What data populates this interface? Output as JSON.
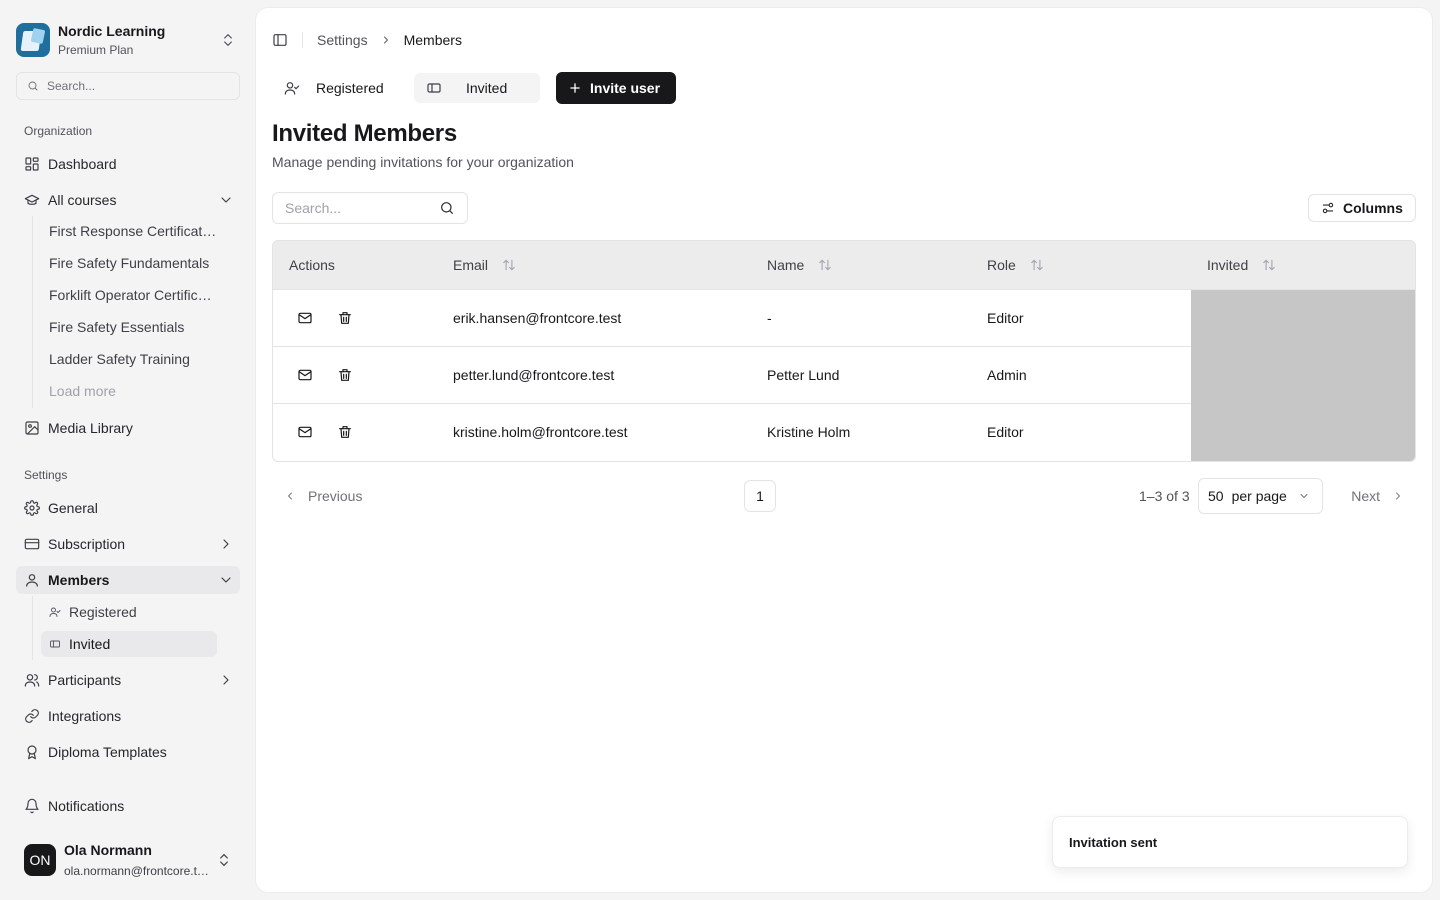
{
  "sidebar": {
    "org": {
      "name": "Nordic Learning",
      "plan": "Premium Plan"
    },
    "search_placeholder": "Search...",
    "organization_label": "Organization",
    "dashboard": "Dashboard",
    "all_courses": "All courses",
    "courses": [
      "First Response Certification",
      "Fire Safety Fundamentals",
      "Forklift Operator Certification",
      "Fire Safety Essentials",
      "Ladder Safety Training"
    ],
    "load_more": "Load more",
    "media_library": "Media Library",
    "settings_label": "Settings",
    "general": "General",
    "subscription": "Subscription",
    "members": "Members",
    "members_sub": {
      "registered": "Registered",
      "invited": "Invited"
    },
    "participants": "Participants",
    "integrations": "Integrations",
    "diploma_templates": "Diploma Templates",
    "notifications": "Notifications",
    "user": {
      "initials": "ON",
      "name": "Ola Normann",
      "email": "ola.normann@frontcore.test"
    }
  },
  "breadcrumb": {
    "parent": "Settings",
    "current": "Members"
  },
  "tabs": {
    "registered": "Registered",
    "invited": "Invited",
    "invite_button": "Invite user"
  },
  "page": {
    "title": "Invited Members",
    "subtitle": "Manage pending invitations for your organization"
  },
  "table_search_placeholder": "Search...",
  "columns_button": "Columns",
  "table": {
    "headers": {
      "actions": "Actions",
      "email": "Email",
      "name": "Name",
      "role": "Role",
      "invited": "Invited"
    },
    "rows": [
      {
        "email": "erik.hansen@frontcore.test",
        "name": "-",
        "role": "Editor"
      },
      {
        "email": "petter.lund@frontcore.test",
        "name": "Petter Lund",
        "role": "Admin"
      },
      {
        "email": "kristine.holm@frontcore.test",
        "name": "Kristine Holm",
        "role": "Editor"
      }
    ]
  },
  "pagination": {
    "previous": "Previous",
    "page": "1",
    "range": "1–3 of 3",
    "per_page_value": "50",
    "per_page_label": "per page",
    "next": "Next"
  },
  "toast": {
    "message": "Invitation sent"
  },
  "colors": {
    "primary": "#18181b",
    "background": "#f4f4f5",
    "placeholder_column": "#c6c6c6",
    "brand_logo": "#1f6f9e"
  }
}
